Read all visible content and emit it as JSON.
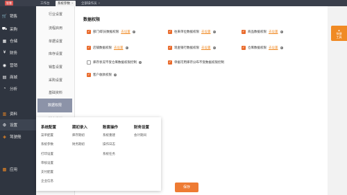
{
  "topbar": {
    "logo": "智慧",
    "tabs": [
      {
        "label": "工作台",
        "active": false
      },
      {
        "label": "系统参数",
        "active": true
      },
      {
        "label": "全部操作员",
        "active": false
      }
    ],
    "close_glyph": "×"
  },
  "sidebar": {
    "items": [
      {
        "label": "销售",
        "icon": "cart-icon",
        "glyph": "🛒"
      },
      {
        "label": "采购",
        "icon": "truck-icon",
        "glyph": "⛟"
      },
      {
        "label": "仓储",
        "icon": "warehouse-icon",
        "glyph": "▦"
      },
      {
        "label": "财务",
        "icon": "money-icon",
        "glyph": "¥"
      },
      {
        "label": "营销",
        "icon": "megaphone-icon",
        "glyph": "◉"
      },
      {
        "label": "商城",
        "icon": "store-icon",
        "glyph": "▤"
      },
      {
        "label": "分析",
        "icon": "chart-icon",
        "glyph": "◔"
      },
      {
        "label": "资料",
        "icon": "folder-icon",
        "glyph": "▥"
      },
      {
        "label": "设置",
        "icon": "gear-icon",
        "glyph": "⚙"
      },
      {
        "label": "驾驶舱",
        "icon": "dashboard-icon",
        "glyph": "◈"
      },
      {
        "label": "应用",
        "icon": "apps-icon",
        "glyph": "▩"
      }
    ]
  },
  "submenu": {
    "items": [
      "行业设置",
      "流程启用",
      "单据设置",
      "库存设置",
      "销售设置",
      "采购设置",
      "基础资料",
      "数据权限",
      "消息推送"
    ],
    "selected_index": 7
  },
  "panel": {
    "title": "数据权限",
    "link_text": "去设置",
    "help_glyph": "?",
    "permissions": [
      {
        "label": "部门/职员数据权限",
        "checked": true,
        "has_link": true
      },
      {
        "label": "往来单位数据权限",
        "checked": true,
        "has_link": true
      },
      {
        "label": "商品数据权限",
        "checked": true,
        "has_link": true
      },
      {
        "label": "店铺数据权限",
        "checked": true,
        "has_link": true
      },
      {
        "label": "现金银行数据权限",
        "checked": true,
        "has_link": true
      },
      {
        "label": "仓库数据权限",
        "checked": true,
        "has_link": true
      },
      {
        "label": "库存状况不受仓库数据权限控制",
        "checked": false,
        "has_link": false
      },
      {
        "label": "单据可用库存分布不受数据权限控制",
        "checked": true,
        "has_link": false
      },
      {
        "label": "客户收款权限",
        "checked": true,
        "has_link": false
      }
    ],
    "save_label": "保存"
  },
  "right_tool": {
    "label_line1": "▲",
    "label_line2": "快捷",
    "label_line3": "工具"
  },
  "flyout": {
    "columns": [
      {
        "title": "系统配置",
        "items": [
          "菜单配置",
          "系统参数",
          "打印设置",
          "审核设置",
          "支付配置",
          "企业信息"
        ]
      },
      {
        "title": "期初录入",
        "items": [
          "库存期初",
          "财务期初"
        ]
      },
      {
        "title": "账套操作",
        "items": [
          "系统重建",
          "操作日志",
          "系统任务"
        ]
      },
      {
        "title": "财务设置",
        "items": [
          "会计期间"
        ]
      }
    ]
  },
  "colors": {
    "accent": "#ee7b33",
    "sidebar_bg": "#2f3540",
    "submenu_selected": "#8c93a8"
  }
}
